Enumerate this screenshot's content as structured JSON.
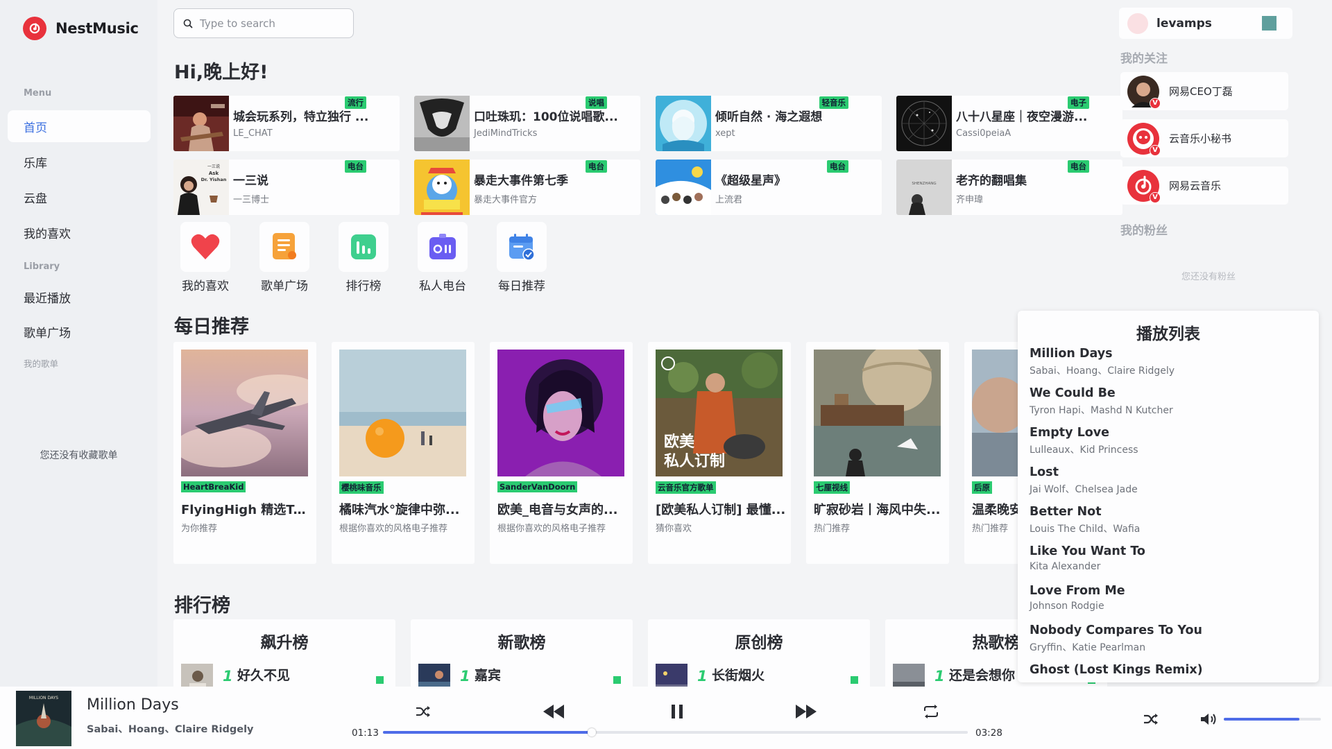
{
  "app": {
    "name": "NestMusic",
    "accent": "#4e6ce8",
    "brand_red": "#e8323c",
    "tag_green": "#2bcb71"
  },
  "sidebar": {
    "menu_heading": "Menu",
    "menu_items": [
      {
        "label": "首页",
        "active": true
      },
      {
        "label": "乐库",
        "active": false
      },
      {
        "label": "云盘",
        "active": false
      },
      {
        "label": "我的喜欢",
        "active": false
      }
    ],
    "library_heading": "Library",
    "library_items": [
      {
        "label": "最近播放"
      },
      {
        "label": "歌单广场"
      }
    ],
    "my_playlists_heading": "我的歌单",
    "empty_text": "您还没有收藏歌单"
  },
  "search": {
    "placeholder": "Type to search",
    "icon": "search-icon"
  },
  "greeting": "Hi,晚上好!",
  "quick_cards": [
    {
      "title": "城会玩系列，特立独行 ...",
      "subtitle": "LE_CHAT",
      "tag": "流行"
    },
    {
      "title": "口吐珠玑：100位说唱歌...",
      "subtitle": "JediMindTricks",
      "tag": "说唱"
    },
    {
      "title": "倾听自然 · 海之遐想",
      "subtitle": "xept",
      "tag": "轻音乐"
    },
    {
      "title": "八十八星座｜夜空漫游...",
      "subtitle": "Cassi0peiaA",
      "tag": "电子"
    },
    {
      "title": "一三说",
      "subtitle": "一三博士",
      "tag": "电台"
    },
    {
      "title": "暴走大事件第七季",
      "subtitle": "暴走大事件官方",
      "tag": "电台"
    },
    {
      "title": "《超级星声》",
      "subtitle": "上流君",
      "tag": "电台"
    },
    {
      "title": "老齐的翻唱集",
      "subtitle": "齐申瑋",
      "tag": "电台"
    }
  ],
  "quick_card_image_text": {
    "ask": "Ask",
    "doctor": "Dr. Yishan",
    "yisanshuo": "一三说",
    "shenzhang": "SHENZHANG"
  },
  "shortcuts": [
    {
      "label": "我的喜欢",
      "icon": "heart-icon"
    },
    {
      "label": "歌单广场",
      "icon": "playlist-square-icon"
    },
    {
      "label": "排行榜",
      "icon": "chart-bars-icon"
    },
    {
      "label": "私人电台",
      "icon": "radio-icon"
    },
    {
      "label": "每日推荐",
      "icon": "calendar-check-icon"
    }
  ],
  "daily_section_title": "每日推荐",
  "daily_cards": [
    {
      "tag": "HeartBreaKid",
      "title": "FlyingHigh 精选Tra...",
      "subtitle": "为你推荐"
    },
    {
      "tag": "樱桃味音乐",
      "title": "橘味汽水°旋律中弥...",
      "subtitle": "根据你喜欢的风格电子推荐"
    },
    {
      "tag": "SanderVanDoorn",
      "title": "欧美_电音与女声的...",
      "subtitle": "根据你喜欢的风格电子推荐"
    },
    {
      "tag": "云音乐官方歌单",
      "title": "[欧美私人订制] 最懂...",
      "subtitle": "猜你喜欢"
    },
    {
      "tag": "七厘视线",
      "title": "旷寂砂岩丨海风中失...",
      "subtitle": "热门推荐"
    },
    {
      "tag": "后原",
      "title": "温柔晚安",
      "subtitle": "热门推荐"
    }
  ],
  "daily_card_overlay": {
    "line1": "欧美",
    "line2": "私人订制"
  },
  "rank_section_title": "排行榜",
  "rank_cards": [
    {
      "title": "飙升榜",
      "num": "1",
      "song": "好久不见"
    },
    {
      "title": "新歌榜",
      "num": "1",
      "song": "嘉宾"
    },
    {
      "title": "原创榜",
      "num": "1",
      "song": "长街烟火"
    },
    {
      "title": "热歌榜",
      "num": "1",
      "song": "还是会想你"
    }
  ],
  "right_panel": {
    "username": "levamps",
    "following_heading": "我的关注",
    "following": [
      {
        "name": "网易CEO丁磊",
        "badge": "V"
      },
      {
        "name": "云音乐小秘书",
        "badge": "V"
      },
      {
        "name": "网易云音乐",
        "badge": "V"
      }
    ],
    "fans_heading": "我的粉丝",
    "no_fans_text": "您还没有粉丝"
  },
  "playlist_popup": {
    "title": "播放列表",
    "items": [
      {
        "name": "Million Days",
        "artists": "Sabai、Hoang、Claire Ridgely"
      },
      {
        "name": "We Could Be",
        "artists": "Tyron Hapi、Mashd N Kutcher"
      },
      {
        "name": "Empty Love",
        "artists": "Lulleaux、Kid Princess"
      },
      {
        "name": "Lost",
        "artists": "Jai Wolf、Chelsea Jade"
      },
      {
        "name": "Better Not",
        "artists": "Louis The Child、Wafia"
      },
      {
        "name": "Like You Want To",
        "artists": "Kita Alexander"
      },
      {
        "name": "Love From Me",
        "artists": "Johnson Rodgie"
      },
      {
        "name": "Nobody Compares To You",
        "artists": "Gryffin、Katie Pearlman"
      },
      {
        "name": "Ghost (Lost Kings Remix)",
        "artists": ""
      }
    ]
  },
  "player": {
    "title": "Million Days",
    "artists": "Sabai、Hoang、Claire Ridgely",
    "cover_text": "MILLION DAYS",
    "current_time": "01:13",
    "total_time": "03:28",
    "progress": 0.357,
    "volume": 0.78,
    "controls": [
      "shuffle-icon",
      "previous-icon",
      "pause-icon",
      "next-icon",
      "repeat-icon"
    ]
  }
}
